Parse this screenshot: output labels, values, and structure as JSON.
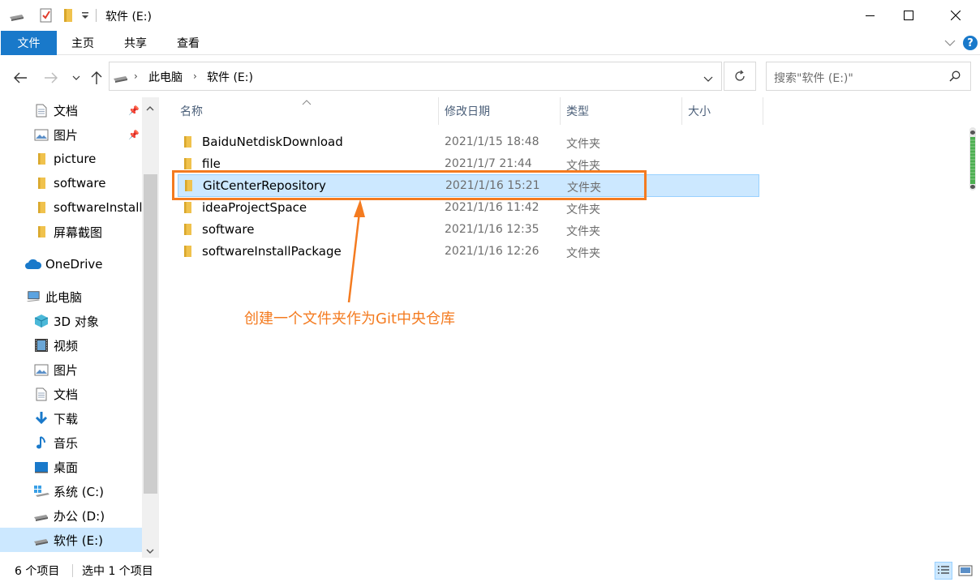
{
  "window": {
    "title": "软件 (E:)"
  },
  "ribbon": {
    "file": "文件",
    "home": "主页",
    "share": "共享",
    "view": "查看",
    "help": "?"
  },
  "address": {
    "crumbs": [
      "此电脑",
      "软件 (E:)"
    ]
  },
  "search": {
    "placeholder": "搜索\"软件 (E:)\""
  },
  "nav": {
    "quick_access": [
      {
        "label": "文档",
        "icon": "documents-icon",
        "pinned": true
      },
      {
        "label": "图片",
        "icon": "pictures-icon",
        "pinned": true
      },
      {
        "label": "picture",
        "icon": "folder-icon",
        "pinned": false
      },
      {
        "label": "software",
        "icon": "folder-icon",
        "pinned": false
      },
      {
        "label": "softwareInstallPackage",
        "icon": "folder-icon",
        "pinned": false
      },
      {
        "label": "屏幕截图",
        "icon": "folder-icon",
        "pinned": false
      }
    ],
    "onedrive": "OneDrive",
    "this_pc": "此电脑",
    "pc_items": [
      {
        "label": "3D 对象",
        "icon": "3d-objects-icon"
      },
      {
        "label": "视频",
        "icon": "videos-icon"
      },
      {
        "label": "图片",
        "icon": "pictures-icon"
      },
      {
        "label": "文档",
        "icon": "documents-icon"
      },
      {
        "label": "下载",
        "icon": "downloads-icon"
      },
      {
        "label": "音乐",
        "icon": "music-icon"
      },
      {
        "label": "桌面",
        "icon": "desktop-icon"
      },
      {
        "label": "系统 (C:)",
        "icon": "windows-drive-icon"
      },
      {
        "label": "办公 (D:)",
        "icon": "drive-icon"
      },
      {
        "label": "软件 (E:)",
        "icon": "drive-icon",
        "selected": true
      }
    ]
  },
  "columns": {
    "name": "名称",
    "date": "修改日期",
    "type": "类型",
    "size": "大小"
  },
  "files": [
    {
      "name": "BaiduNetdiskDownload",
      "date": "2021/1/15 18:48",
      "type": "文件夹"
    },
    {
      "name": "file",
      "date": "2021/1/7 21:44",
      "type": "文件夹"
    },
    {
      "name": "GitCenterRepository",
      "date": "2021/1/16 15:21",
      "type": "文件夹",
      "selected": true
    },
    {
      "name": "ideaProjectSpace",
      "date": "2021/1/16 11:42",
      "type": "文件夹"
    },
    {
      "name": "software",
      "date": "2021/1/16 12:35",
      "type": "文件夹"
    },
    {
      "name": "softwareInstallPackage",
      "date": "2021/1/16 12:26",
      "type": "文件夹"
    }
  ],
  "annotation": "创建一个文件夹作为Git中央仓库",
  "status": {
    "count": "6 个项目",
    "selected": "选中 1 个项目"
  },
  "colors": {
    "accent": "#1979ca",
    "selection": "#cce8ff",
    "annotation": "#f47b20",
    "folder": "#f0c24d"
  }
}
